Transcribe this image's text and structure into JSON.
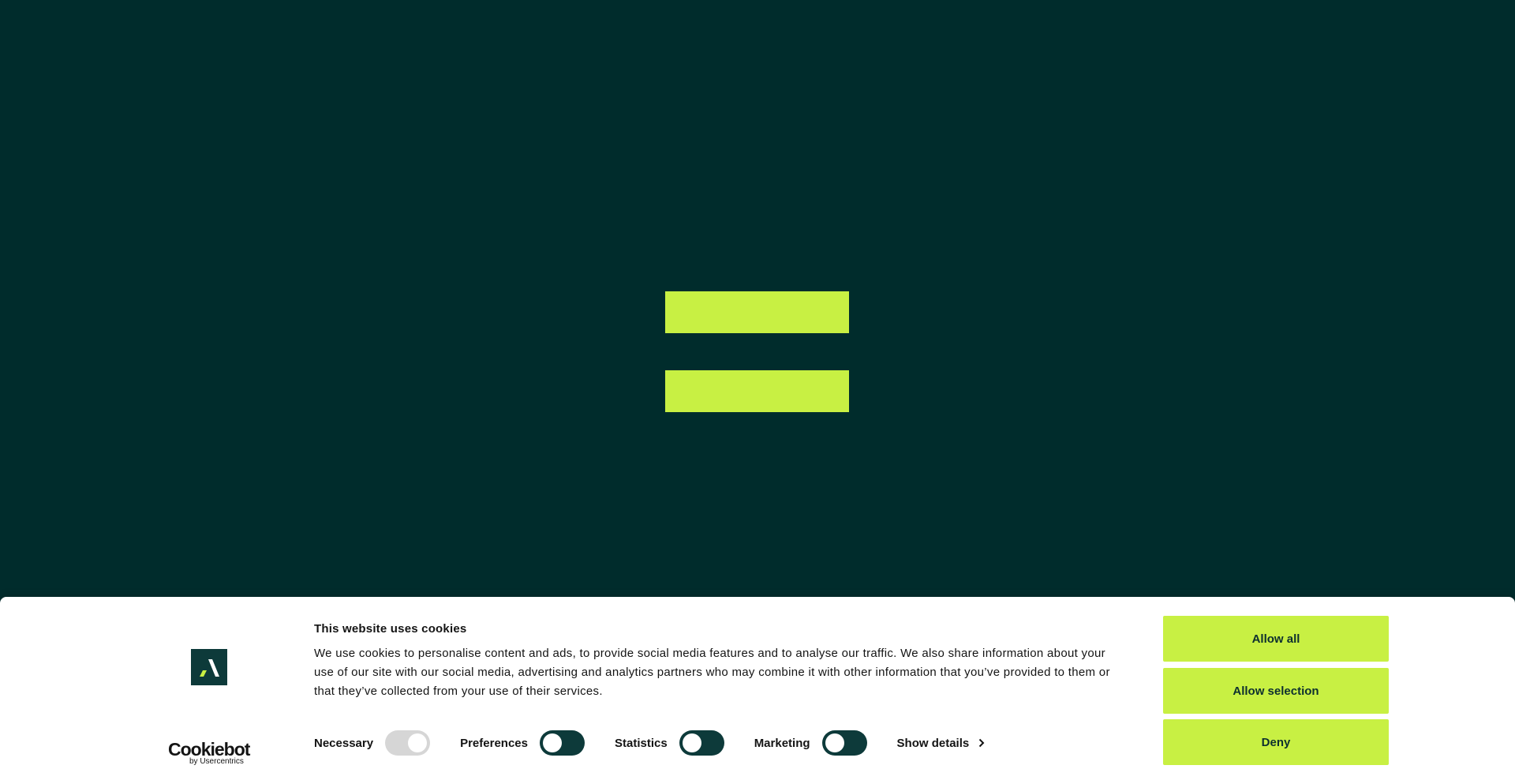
{
  "colors": {
    "background": "#002c2c",
    "accent": "#c8f043",
    "banner_bg": "#ffffff",
    "toggle_off": "#0d3a3a",
    "toggle_disabled": "#d6d6d6"
  },
  "loader": {
    "icon": "equals-logo-icon"
  },
  "cookie_banner": {
    "brand_logo_icon": "brand-lambda-icon",
    "cookiebot_logo": {
      "name": "Cookiebot",
      "sub": "by Usercentrics"
    },
    "title": "This website uses cookies",
    "text": "We use cookies to personalise content and ads, to provide social media features and to analyse our traffic. We also share information about your use of our site with our social media, advertising and analytics partners who may combine it with other information that you’ve provided to them or that they’ve collected from your use of their services.",
    "categories": [
      {
        "label": "Necessary",
        "checked": true,
        "disabled": true
      },
      {
        "label": "Preferences",
        "checked": false,
        "disabled": false
      },
      {
        "label": "Statistics",
        "checked": false,
        "disabled": false
      },
      {
        "label": "Marketing",
        "checked": false,
        "disabled": false
      }
    ],
    "show_details": "Show details",
    "buttons": {
      "allow_all": "Allow all",
      "allow_selection": "Allow selection",
      "deny": "Deny"
    }
  }
}
